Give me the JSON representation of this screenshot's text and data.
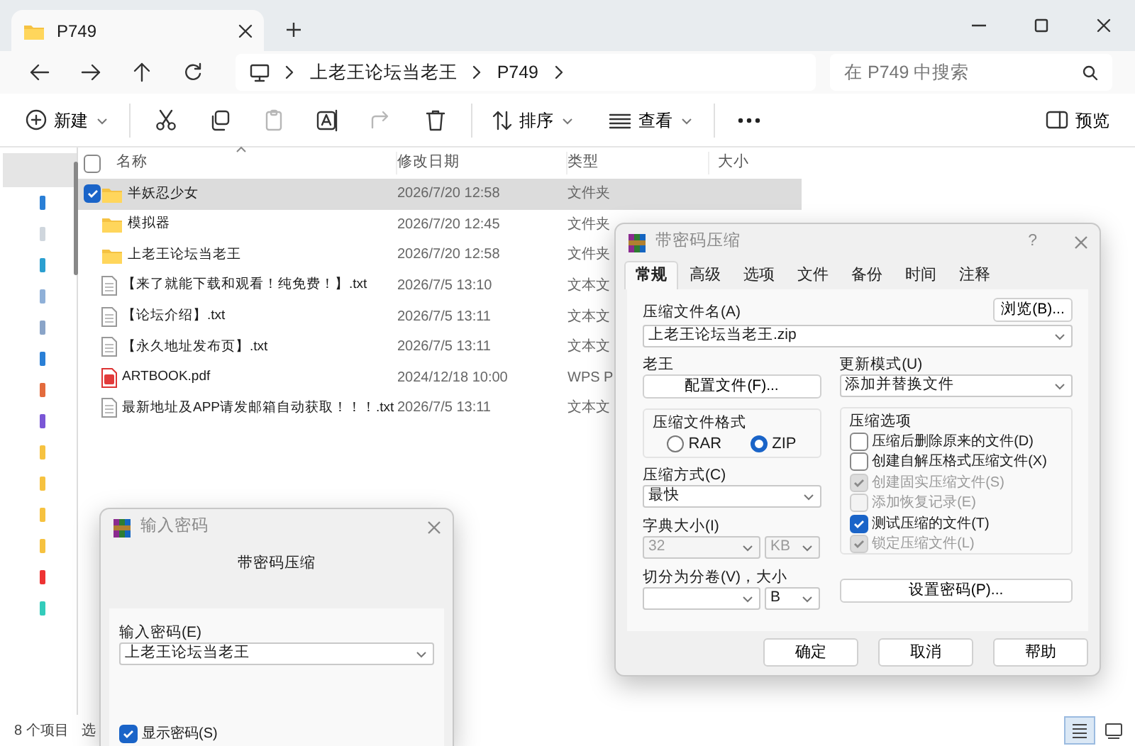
{
  "window": {
    "tab_title": "P749"
  },
  "address": {
    "path": [
      "上老王论坛当老王",
      "P749"
    ],
    "search": {
      "placeholder": "在 P749 中搜索"
    }
  },
  "toolbar": {
    "new": "新建",
    "sort": "排序",
    "view": "查看",
    "preview": "预览",
    "tools": [
      {
        "kind": "cut",
        "disabled": false
      },
      {
        "kind": "copy",
        "disabled": false
      },
      {
        "kind": "paste",
        "disabled": true
      },
      {
        "kind": "rename",
        "disabled": false
      },
      {
        "kind": "share",
        "disabled": true
      },
      {
        "kind": "delete",
        "disabled": false
      }
    ]
  },
  "select_all_checked": false,
  "columns": [
    "名称",
    "修改日期",
    "类型",
    "大小"
  ],
  "rows": [
    {
      "kind": "folder",
      "name": "半妖忍少女",
      "date": "2026/7/20 12:58",
      "type": "文件夹",
      "selected": true
    },
    {
      "kind": "folder",
      "name": "模拟器",
      "date": "2026/7/20 12:45",
      "type": "文件夹",
      "selected": false
    },
    {
      "kind": "folder",
      "name": "上老王论坛当老王",
      "date": "2026/7/20 12:58",
      "type": "文件夹",
      "selected": false
    },
    {
      "kind": "text",
      "name": "【来了就能下载和观看！纯免费！】.txt",
      "date": "2026/7/5 13:10",
      "type": "文本文",
      "selected": false
    },
    {
      "kind": "text",
      "name": "【论坛介绍】.txt",
      "date": "2026/7/5 13:11",
      "type": "文本文",
      "selected": false
    },
    {
      "kind": "text",
      "name": "【永久地址发布页】.txt",
      "date": "2026/7/5 13:11",
      "type": "文本文",
      "selected": false
    },
    {
      "kind": "pdf",
      "name": "ARTBOOK.pdf",
      "date": "2024/12/18 10:00",
      "type": "WPS P",
      "selected": false
    },
    {
      "kind": "text",
      "name": "最新地址及APP请发邮箱自动获取！！！.txt",
      "date": "2026/7/5 13:11",
      "type": "文本文",
      "selected": false
    }
  ],
  "status_bar": {
    "count": "8 个项目",
    "selection": "选"
  },
  "view_buttons": [
    {
      "kind": "details",
      "selected": true
    },
    {
      "kind": "tiles",
      "selected": false
    }
  ],
  "rar_dialog": {
    "title": "带密码压缩",
    "help": "?",
    "tabs": [
      {
        "label": "常规",
        "selected": true
      },
      {
        "label": "高级",
        "selected": false
      },
      {
        "label": "选项",
        "selected": false
      },
      {
        "label": "文件",
        "selected": false
      },
      {
        "label": "备份",
        "selected": false
      },
      {
        "label": "时间",
        "selected": false
      },
      {
        "label": "注释",
        "selected": false
      }
    ],
    "archive_name_label": "压缩文件名(A)",
    "browse": "浏览(B)...",
    "archive_name": "上老王论坛当老王.zip",
    "profile_label": "老王",
    "profile_button": "配置文件(F)...",
    "update_label": "更新模式(U)",
    "update_mode": "添加并替换文件",
    "format_label": "压缩文件格式",
    "formats": [
      {
        "label": "RAR",
        "selected": false
      },
      {
        "label": "ZIP",
        "selected": true
      }
    ],
    "method_label": "压缩方式(C)",
    "method": "最快",
    "dict_label": "字典大小(I)",
    "dict_size": "32",
    "dict_unit": "KB",
    "dict_disabled": true,
    "split_label": "切分为分卷(V)，大小",
    "split_unit": "B",
    "options_label": "压缩选项",
    "options": [
      {
        "label": "压缩后删除原来的文件(D)",
        "checked": false,
        "disabled": false
      },
      {
        "label": "创建自解压格式压缩文件(X)",
        "checked": false,
        "disabled": false
      },
      {
        "label": "创建固实压缩文件(S)",
        "checked": true,
        "disabled": true
      },
      {
        "label": "添加恢复记录(E)",
        "checked": false,
        "disabled": true
      },
      {
        "label": "测试压缩的文件(T)",
        "checked": true,
        "disabled": false
      },
      {
        "label": "锁定压缩文件(L)",
        "checked": true,
        "disabled": true
      }
    ],
    "password_button": "设置密码(P)...",
    "buttons": [
      "确定",
      "取消",
      "帮助"
    ]
  },
  "password_dialog": {
    "title": "输入密码",
    "heading": "带密码压缩",
    "label": "输入密码(E)",
    "value": "上老王论坛当老王",
    "show_label": "显示密码(S)",
    "show_checked": true
  }
}
